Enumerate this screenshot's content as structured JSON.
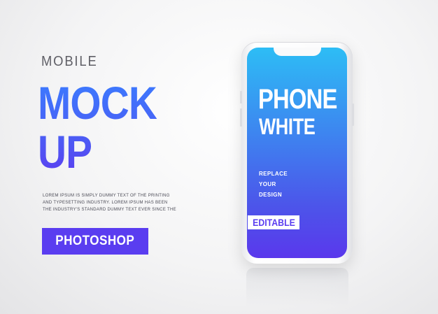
{
  "left": {
    "eyebrow": "MOBILE",
    "headline_line1": "MOCK",
    "headline_line2": "UP",
    "body_line1": "LOREM IPSUM IS SIMPLY DUMMY TEXT OF THE PRINTING",
    "body_line2": "AND TYPESETTING INDUSTRY. LOREM IPSUM HAS BEEN",
    "body_line3": "THE INDUSTRY'S STANDARD DUMMY TEXT EVER SINCE THE",
    "badge_label": "PHOTOSHOP"
  },
  "phone": {
    "title": "PHONE",
    "subtitle": "WHITE",
    "line1": "REPLACE",
    "line2": "YOUR",
    "line3": "DESIGN",
    "tag_label": "EDITABLE"
  },
  "colors": {
    "accent_purple": "#5a3df0",
    "accent_blue": "#3b7bff",
    "screen_top": "#2dbdf5",
    "screen_bottom": "#5a38ec"
  },
  "icons": [
    "phone-notch-icon"
  ]
}
